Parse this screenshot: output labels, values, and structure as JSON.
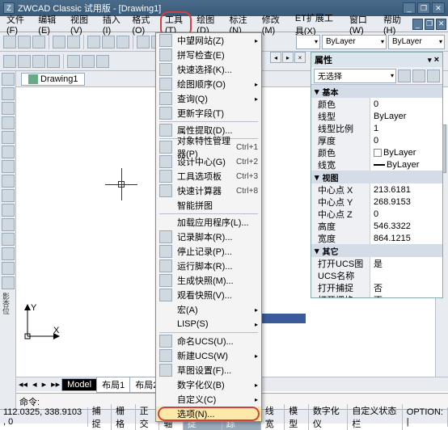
{
  "title": "ZWCAD Classic 试用版 - [Drawing1]",
  "menubar": [
    "文件(F)",
    "编辑(E)",
    "视图(V)",
    "插入(I)",
    "格式(O)",
    "工具(T)",
    "绘图(D)",
    "标注(N)",
    "修改(M)",
    "ET扩展工具(X)",
    "窗口(W)",
    "帮助(H)"
  ],
  "hl_menu_index": 5,
  "layer_combos": {
    "bylayer1": "ByLayer",
    "bylayer2": "ByLayer"
  },
  "doc_tab": "Drawing1",
  "sheet_tabs": {
    "active": "Model",
    "others": [
      "布局1",
      "布局2"
    ],
    "nav": [
      "◂◂",
      "◂",
      "▸",
      "▸▸"
    ]
  },
  "cmd_prompt": "命令:",
  "cmd_side": "影杏位",
  "dropdown": [
    {
      "label": "中望网站(Z)",
      "arrow": true,
      "ico": true
    },
    {
      "label": "拼写检查(E)",
      "ico": true
    },
    {
      "label": "快速选择(K)...",
      "ico": true
    },
    {
      "label": "绘图顺序(O)",
      "arrow": true,
      "ico": true
    },
    {
      "label": "查询(Q)",
      "arrow": true,
      "ico": true
    },
    {
      "label": "更新字段(T)",
      "ico": true
    },
    {
      "sep": true
    },
    {
      "label": "属性提取(D)...",
      "ico": true
    },
    {
      "sep": true
    },
    {
      "label": "对象特性管理器(P)",
      "sc": "Ctrl+1",
      "ico": true
    },
    {
      "label": "设计中心(G)",
      "sc": "Ctrl+2",
      "ico": true
    },
    {
      "label": "工具选项板",
      "sc": "Ctrl+3",
      "ico": true
    },
    {
      "label": "快速计算器",
      "sc": "Ctrl+8",
      "ico": true
    },
    {
      "label": "智能拼图"
    },
    {
      "sep": true
    },
    {
      "label": "加载应用程序(L)..."
    },
    {
      "label": "记录脚本(R)...",
      "ico": true
    },
    {
      "label": "停止记录(P)...",
      "ico": true
    },
    {
      "label": "运行脚本(R)...",
      "ico": true
    },
    {
      "label": "生成快照(M)...",
      "ico": true
    },
    {
      "label": "观看快照(V)...",
      "ico": true
    },
    {
      "label": "宏(A)",
      "arrow": true
    },
    {
      "label": "LISP(S)",
      "arrow": true
    },
    {
      "sep": true
    },
    {
      "label": "命名UCS(U)...",
      "ico": true
    },
    {
      "label": "新建UCS(W)",
      "arrow": true,
      "ico": true
    },
    {
      "label": "草图设置(F)...",
      "ico": true
    },
    {
      "label": "数字化仪(B)",
      "arrow": true
    },
    {
      "label": "自定义(C)",
      "arrow": true
    },
    {
      "label": "选项(N)...",
      "sel": true,
      "ring": true
    }
  ],
  "properties": {
    "title": "属性",
    "selector": "无选择",
    "groups": [
      {
        "name": "基本",
        "rows": [
          {
            "k": "颜色",
            "v": "0"
          },
          {
            "k": "线型",
            "v": "ByLayer"
          },
          {
            "k": "线型比例",
            "v": "1"
          },
          {
            "k": "厚度",
            "v": "0"
          },
          {
            "k": "颜色",
            "v": "ByLayer",
            "sw": true
          },
          {
            "k": "线宽",
            "v": "ByLayer",
            "lw": true
          }
        ]
      },
      {
        "name": "视图",
        "rows": [
          {
            "k": "中心点 X",
            "v": "213.6181"
          },
          {
            "k": "中心点 Y",
            "v": "268.9153"
          },
          {
            "k": "中心点 Z",
            "v": "0"
          },
          {
            "k": "高度",
            "v": "546.3322"
          },
          {
            "k": "宽度",
            "v": "864.1215"
          }
        ]
      },
      {
        "name": "其它",
        "rows": [
          {
            "k": "打开UCS图标:",
            "v": "是"
          },
          {
            "k": "UCS名称",
            "v": ""
          },
          {
            "k": "打开捕捉",
            "v": "否"
          },
          {
            "k": "打开栅格",
            "v": "否"
          }
        ]
      }
    ]
  },
  "status": {
    "coords": "112.0325, 338.9103 , 0",
    "cells": [
      "捕捉",
      "栅格",
      "正交",
      "极轴",
      "对象捕捉",
      "对象追踪",
      "线宽",
      "模型"
    ],
    "on": [
      4,
      5
    ],
    "right": [
      "数字化仪",
      "自定义状态栏",
      "OPTION: |"
    ]
  },
  "ucs_labels": {
    "x": "X",
    "y": "Y"
  },
  "close_x": "×",
  "pin": "📌",
  "dash": "–"
}
